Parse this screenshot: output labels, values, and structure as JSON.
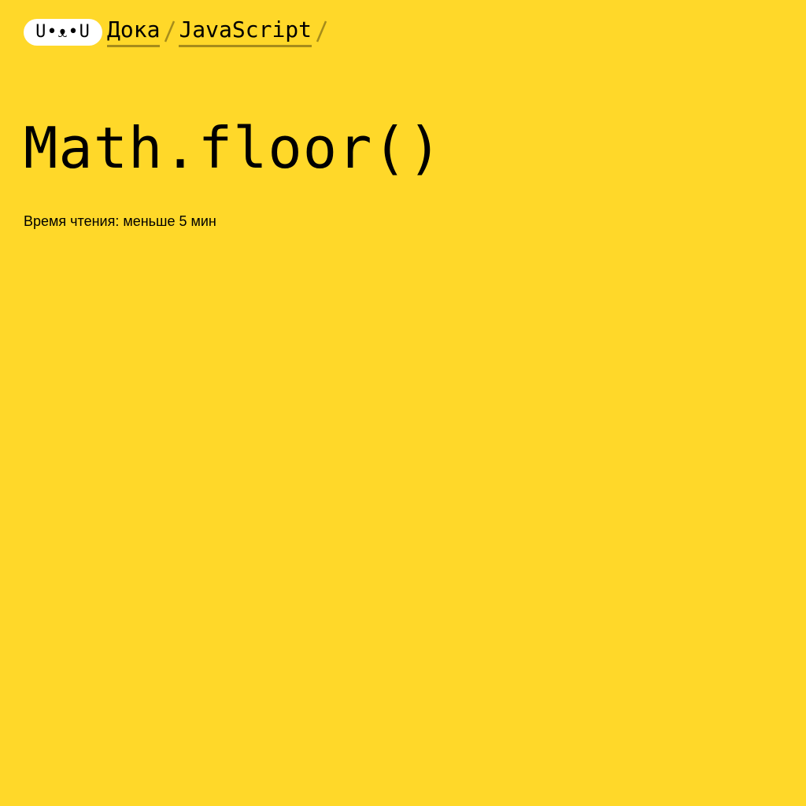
{
  "logo": {
    "text": "U•ᴥ•U"
  },
  "breadcrumbs": [
    {
      "label": "Дока"
    },
    {
      "label": "JavaScript"
    }
  ],
  "article": {
    "title": "Math.floor()",
    "reading_time": "Время чтения: меньше 5 мин"
  },
  "colors": {
    "background": "#ffd829",
    "text": "#000000",
    "logo_bg": "#ffffff"
  },
  "icons": {
    "separator": "slash-separator-icon"
  }
}
